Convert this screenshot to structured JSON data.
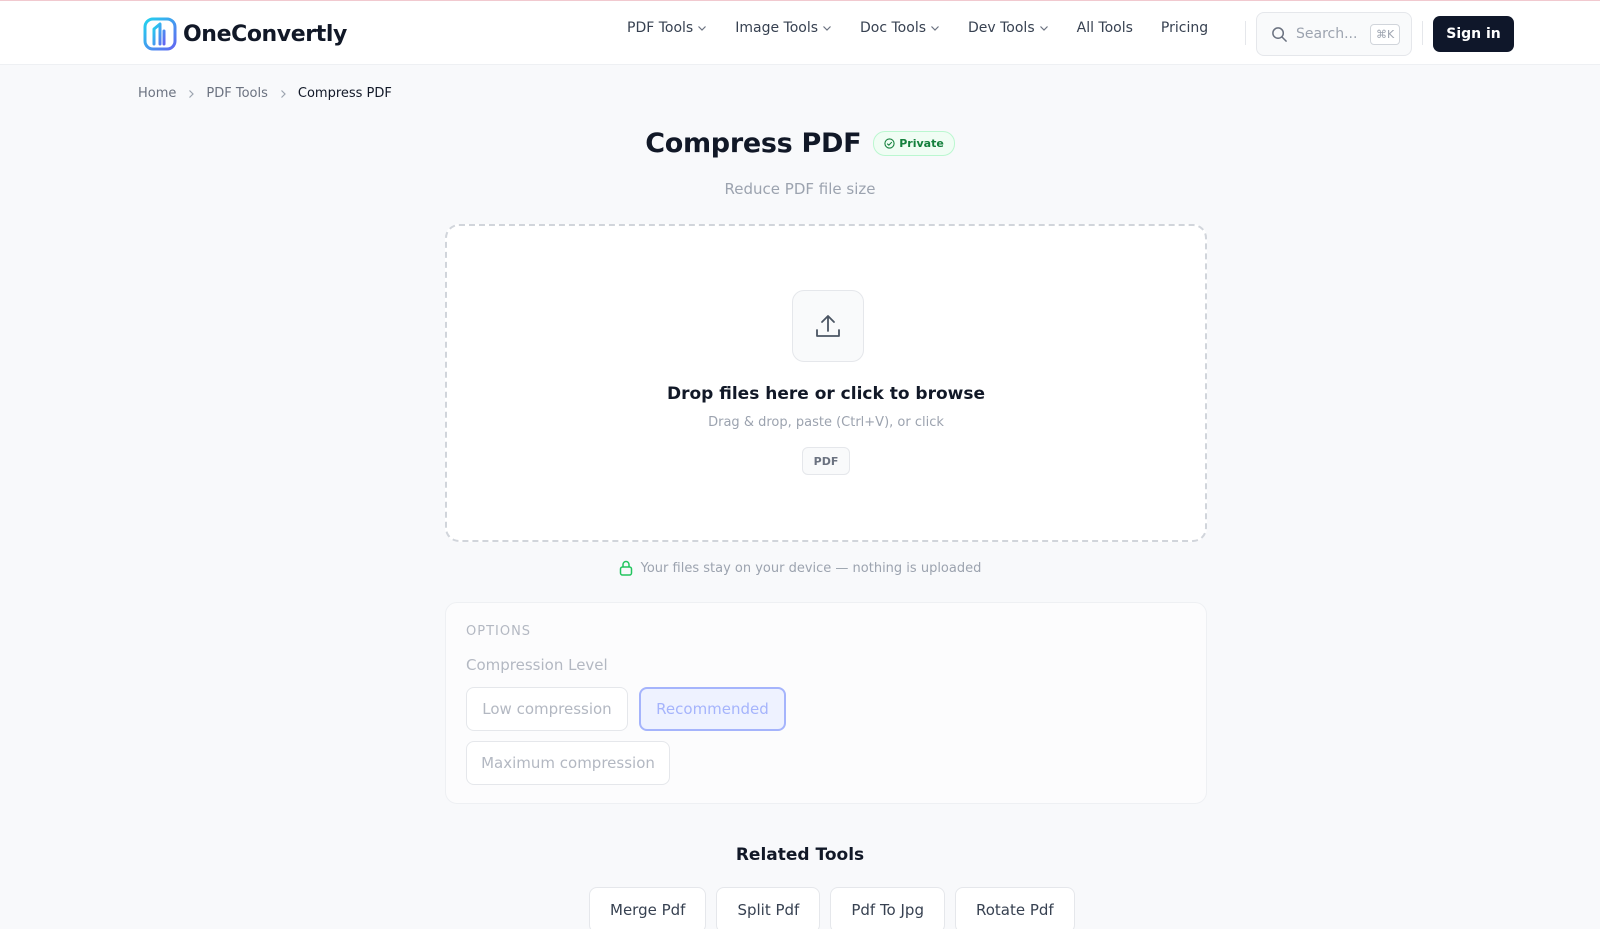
{
  "app": {
    "name": "OneConvertly"
  },
  "nav": {
    "items": [
      {
        "label": "PDF Tools",
        "dropdown": true
      },
      {
        "label": "Image Tools",
        "dropdown": true
      },
      {
        "label": "Doc Tools",
        "dropdown": true
      },
      {
        "label": "Dev Tools",
        "dropdown": true
      },
      {
        "label": "All Tools",
        "dropdown": false
      },
      {
        "label": "Pricing",
        "dropdown": false
      }
    ]
  },
  "search": {
    "placeholder": "Search...",
    "shortcut": "⌘K"
  },
  "auth": {
    "signin_label": "Sign in"
  },
  "breadcrumb": {
    "items": [
      "Home",
      "PDF Tools",
      "Compress PDF"
    ]
  },
  "page": {
    "title": "Compress PDF",
    "badge": "Private",
    "subtitle": "Reduce PDF file size"
  },
  "dropzone": {
    "title": "Drop files here or click to browse",
    "subtitle": "Drag & drop, paste (Ctrl+V), or click",
    "file_type": "PDF"
  },
  "privacy_note": "Your files stay on your device — nothing is uploaded",
  "options": {
    "section_label": "OPTIONS",
    "field_label": "Compression Level",
    "choices": [
      {
        "label": "Low compression",
        "selected": false
      },
      {
        "label": "Recommended",
        "selected": true
      },
      {
        "label": "Maximum compression",
        "selected": false
      }
    ]
  },
  "related": {
    "title": "Related Tools",
    "items": [
      "Merge Pdf",
      "Split Pdf",
      "Pdf To Jpg",
      "Rotate Pdf"
    ]
  },
  "colors": {
    "primary_dark": "#0f172a",
    "accent": "#a5b4fc",
    "success": "#15803d",
    "logo_gradient": [
      "#22d3ee",
      "#6366f1"
    ]
  },
  "icons": [
    "logo-icon",
    "chevron-down-icon",
    "search-icon",
    "chevron-right-icon",
    "shield-check-icon",
    "upload-icon",
    "lock-icon"
  ]
}
